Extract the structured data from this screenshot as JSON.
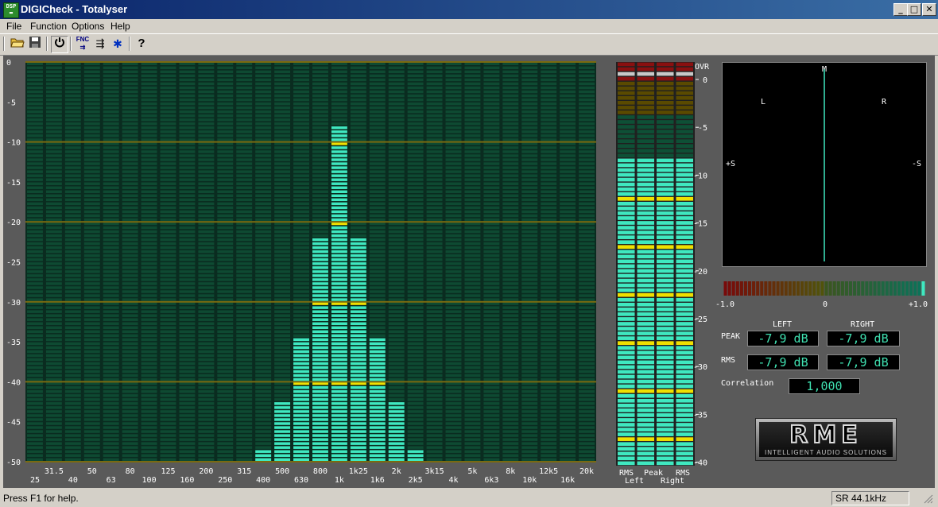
{
  "window": {
    "title": "DIGICheck - Totalyser",
    "app_icon": "dsp-icon",
    "controls": [
      "minimize-icon",
      "maximize-icon",
      "close-icon"
    ]
  },
  "menu": {
    "items": [
      "File",
      "Function",
      "Options",
      "Help"
    ]
  },
  "toolbar": {
    "buttons": [
      "open-folder-icon",
      "save-disk-icon",
      "power-icon",
      "fnc-icon",
      "settings-icon",
      "bug-icon",
      "help-icon"
    ],
    "fnc_label": "FNC"
  },
  "spectrum": {
    "y_labels": [
      "0",
      "-5",
      "-10",
      "-15",
      "-20",
      "-25",
      "-30",
      "-35",
      "-40",
      "-45",
      "-50"
    ],
    "bands_upper_row": [
      "31.5",
      "50",
      "80",
      "125",
      "200",
      "315",
      "500",
      "800",
      "1k25",
      "2k",
      "3k15",
      "5k",
      "8k",
      "12k5",
      "20k"
    ],
    "bands_lower_row": [
      "25",
      "40",
      "63",
      "100",
      "160",
      "250",
      "400",
      "630",
      "1k",
      "1k6",
      "2k5",
      "4k",
      "6k3",
      "10k",
      "16k"
    ],
    "band_order": [
      "25",
      "31.5",
      "40",
      "50",
      "63",
      "80",
      "100",
      "125",
      "160",
      "200",
      "250",
      "315",
      "400",
      "500",
      "630",
      "800",
      "1k",
      "1k25",
      "1k6",
      "2k",
      "2k5",
      "3k15",
      "4k",
      "5k",
      "6k3",
      "8k",
      "10k",
      "12k5",
      "16k",
      "20k"
    ],
    "band_levels_db": [
      -50,
      -50,
      -50,
      -50,
      -50,
      -50,
      -50,
      -50,
      -50,
      -50,
      -50,
      -50,
      -48.5,
      -42.5,
      -34.5,
      -22,
      -8,
      -22,
      -34.5,
      -42.5,
      -48.5,
      -50,
      -50,
      -50,
      -50,
      -50,
      -50,
      -50,
      -50,
      -50
    ],
    "range_db": [
      -50,
      0
    ],
    "colors": {
      "lit": "#3fe8c0",
      "unlit": "#0e4a32",
      "marker": "#f0e000",
      "grid": "#7a6a10",
      "bg": "#5a5a5a"
    }
  },
  "level_meters": {
    "ovr_label": "OVR",
    "scale_labels": [
      "0",
      "-5",
      "-10",
      "-15",
      "-20",
      "-25",
      "-30",
      "-35",
      "-40"
    ],
    "columns": [
      {
        "top": "RMS",
        "level_db": -7.9
      },
      {
        "top": "Peak",
        "level_db": -7.9
      },
      {
        "top": "Peak",
        "level_db": -7.9
      },
      {
        "top": "RMS",
        "level_db": -7.9
      }
    ],
    "bottom_top_labels": [
      "RMS",
      "Peak",
      "RMS"
    ],
    "bottom_channel_labels": [
      "Left",
      "Right"
    ],
    "range_db": [
      -40,
      0
    ]
  },
  "goniometer": {
    "label_m": "M",
    "label_l": "L",
    "label_r": "R",
    "label_plus_s": "+S",
    "label_minus_s": "-S"
  },
  "correlation_meter": {
    "min_label": "-1.0",
    "mid_label": "0",
    "max_label": "+1.0",
    "value": 1.0
  },
  "readouts": {
    "left_header": "LEFT",
    "right_header": "RIGHT",
    "peak_label": "PEAK",
    "rms_label": "RMS",
    "peak_left": "-7,9 dB",
    "peak_right": "-7,9 dB",
    "rms_left": "-7,9 dB",
    "rms_right": "-7,9 dB",
    "correlation_label": "Correlation",
    "correlation_value": "1,000"
  },
  "logo": {
    "name": "RME",
    "tagline": "INTELLIGENT AUDIO SOLUTIONS"
  },
  "status": {
    "help_text": "Press F1 for help.",
    "sample_rate": "SR 44.1kHz"
  }
}
